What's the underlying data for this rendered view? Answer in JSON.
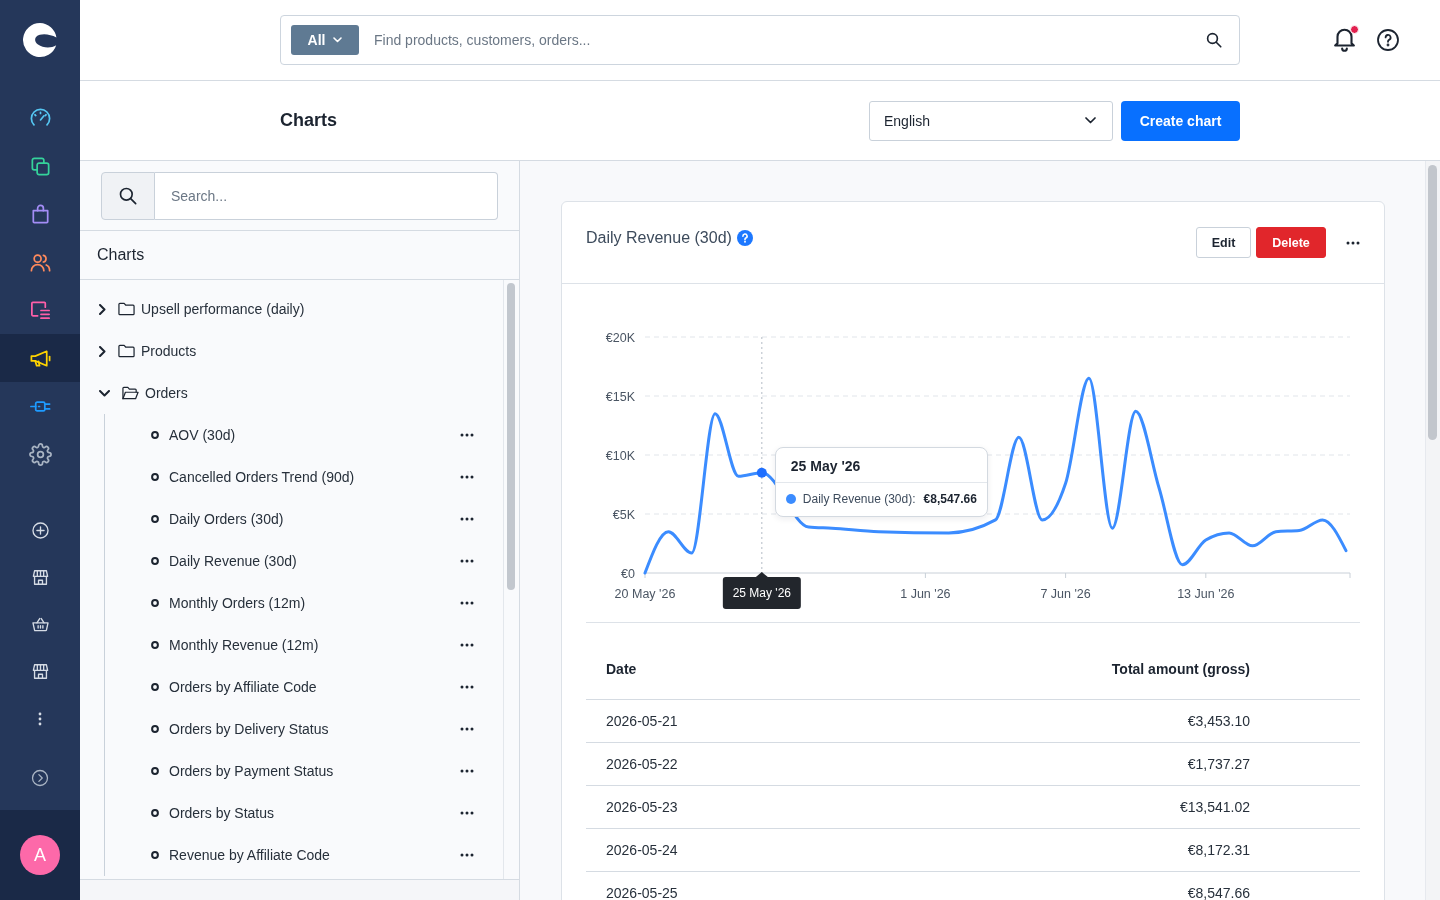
{
  "nav": {
    "items": [
      {
        "selected": false
      },
      {
        "selected": false
      },
      {
        "selected": false
      },
      {
        "selected": false
      },
      {
        "selected": false
      },
      {
        "selected": true
      },
      {
        "selected": false
      },
      {
        "selected": false
      }
    ]
  },
  "user": {
    "initial": "A"
  },
  "header": {
    "search": {
      "scope": "All",
      "placeholder": "Find products, customers, orders..."
    },
    "notifications": {
      "unread": true
    }
  },
  "page": {
    "title": "Charts",
    "language": "English",
    "create_button": "Create chart"
  },
  "sidebar": {
    "search": {
      "placeholder": "Search..."
    },
    "title": "Charts",
    "tree": [
      {
        "label": "Upsell performance (daily)",
        "expanded": false
      },
      {
        "label": "Products",
        "expanded": false
      },
      {
        "label": "Orders",
        "expanded": true,
        "children": [
          {
            "label": "AOV (30d)"
          },
          {
            "label": "Cancelled Orders Trend (90d)"
          },
          {
            "label": "Daily Orders (30d)"
          },
          {
            "label": "Daily Revenue (30d)"
          },
          {
            "label": "Monthly Orders (12m)"
          },
          {
            "label": "Monthly Revenue (12m)"
          },
          {
            "label": "Orders by Affiliate Code"
          },
          {
            "label": "Orders by Delivery Status"
          },
          {
            "label": "Orders by Payment Status"
          },
          {
            "label": "Orders by Status"
          },
          {
            "label": "Revenue by Affiliate Code"
          }
        ]
      }
    ]
  },
  "chart_card": {
    "title": "Daily Revenue (30d)",
    "buttons": [
      {
        "label": "Edit",
        "kind": "secondary"
      },
      {
        "label": "Delete",
        "kind": "danger"
      }
    ],
    "chart_data": {
      "type": "line",
      "grid": true,
      "categories": [
        "20 May '26",
        null,
        null,
        null,
        null,
        "25 May '26",
        null,
        null,
        null,
        null,
        null,
        null,
        "1 Jun '26",
        null,
        null,
        null,
        null,
        null,
        "7 Jun '26",
        null,
        null,
        null,
        null,
        null,
        "13 Jun '26",
        null,
        null,
        null,
        null,
        null,
        null
      ],
      "ylim": [
        0,
        20000
      ],
      "yticks": [
        {
          "value": 0,
          "label": "€0"
        },
        {
          "value": 5000,
          "label": "€5K"
        },
        {
          "value": 10000,
          "label": "€10K"
        },
        {
          "value": 15000,
          "label": "€15K"
        },
        {
          "value": 20000,
          "label": "€20K"
        }
      ],
      "series": [
        {
          "color": "#3b8cff",
          "values": [
            0,
            3500,
            1700,
            13500,
            8200,
            8500,
            null,
            3900,
            3800,
            null,
            3500,
            null,
            null,
            3400,
            null,
            4500,
            11500,
            4500,
            7600,
            16500,
            3800,
            13700,
            7200,
            700,
            2800,
            3400,
            2300,
            3500,
            3600,
            4500,
            1900
          ]
        },
        {
          "color": "#1f6fff",
          "marker": true,
          "values": [
            null,
            null,
            null,
            null,
            null,
            8500,
            null,
            null,
            null,
            null,
            null,
            null,
            null,
            null,
            null,
            null,
            null,
            null,
            null,
            null,
            null,
            null,
            null,
            null,
            null,
            null,
            null,
            null,
            null,
            null,
            null
          ]
        }
      ]
    },
    "tooltip": {
      "title": "25 May '26",
      "label": "Daily Revenue (30d):",
      "value": "€8,547.66"
    },
    "table": {
      "columns": [
        "Date",
        "Total amount (gross)"
      ],
      "rows": [
        [
          "2026-05-21",
          "€3,453.10"
        ],
        [
          "2026-05-22",
          "€1,737.27"
        ],
        [
          "2026-05-23",
          "€13,541.02"
        ],
        [
          "2026-05-24",
          "€8,172.31"
        ],
        [
          "2026-05-25",
          "€8,547.66"
        ]
      ]
    }
  }
}
